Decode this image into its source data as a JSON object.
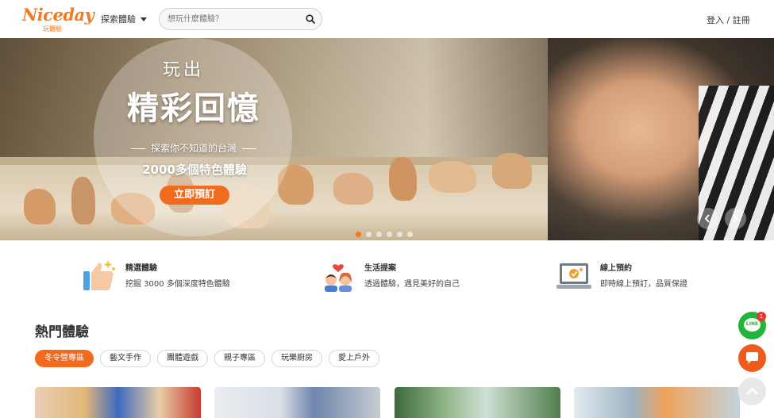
{
  "header": {
    "logo_text": "Niceday",
    "logo_subtext": "玩體驗",
    "explore_label": "探索體驗",
    "search_placeholder": "想玩什麼體驗？",
    "login_label": "登入 / 註冊"
  },
  "hero": {
    "line1": "玩出",
    "line2": "精彩回憶",
    "line3": "探索你不知道的台灣",
    "line4": "2000多個特色體驗",
    "cta_label": "立即預訂",
    "dot_count": 6,
    "active_dot": 0
  },
  "features": [
    {
      "icon": "thumbs-up-sparkle-icon",
      "title": "精選體驗",
      "desc": "挖掘 3000 多個深度特色體驗"
    },
    {
      "icon": "couple-heart-icon",
      "title": "生活提案",
      "desc": "透過體驗，遇見美好的自己"
    },
    {
      "icon": "laptop-check-icon",
      "title": "線上預約",
      "desc": "即時線上預訂，品質保證"
    }
  ],
  "popular": {
    "title": "熱門體驗",
    "tabs": [
      "冬令營專區",
      "藝文手作",
      "團體遊戲",
      "親子專區",
      "玩樂廚房",
      "愛上戶外"
    ],
    "active_tab": 0
  },
  "floating": {
    "line_label": "LINE",
    "line_badge": "1"
  },
  "colors": {
    "brand_orange": "#f26b1d",
    "line_green": "#22b53a"
  }
}
